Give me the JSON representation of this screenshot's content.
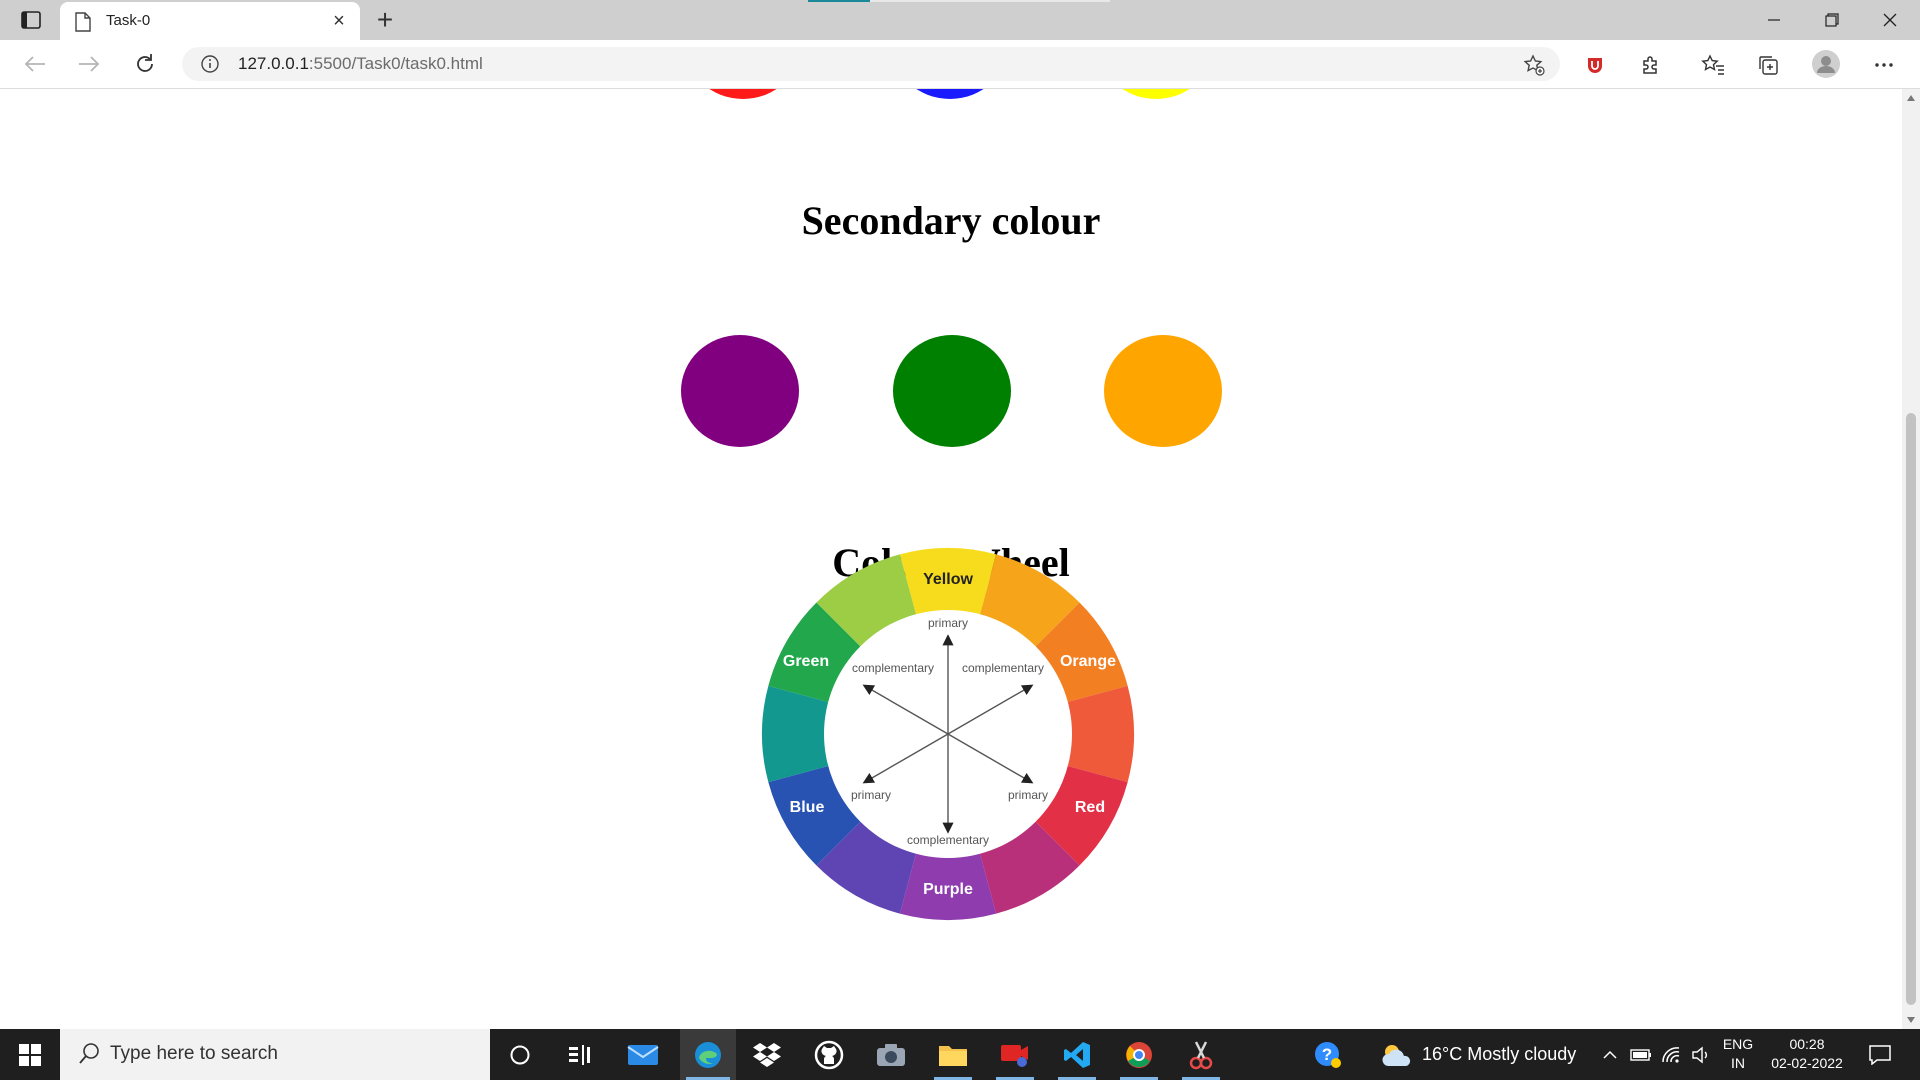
{
  "browser": {
    "tab_title": "Task-0",
    "url_host": "127.0.0.1",
    "url_rest": ":5500/Task0/task0.html"
  },
  "page": {
    "primary_circles_colors": [
      "#ff1a1a",
      "#1a1aff",
      "#ffff00"
    ],
    "secondary_heading": "Secondary colour",
    "secondary_colors": [
      "#800080",
      "#008000",
      "#ffa500"
    ],
    "wheel_heading": "Colour Wheel",
    "wheel": {
      "labels": {
        "yellow": "Yellow",
        "orange": "Orange",
        "red": "Red",
        "purple": "Purple",
        "blue": "Blue",
        "green": "Green"
      },
      "inner": {
        "primary_top": "primary",
        "primary_left": "primary",
        "primary_right": "primary",
        "comp_left": "complementary",
        "comp_right": "complementary",
        "comp_bottom": "complementary"
      }
    }
  },
  "taskbar": {
    "search_placeholder": "Type here to search",
    "weather": "16°C  Mostly cloudy",
    "lang_top": "ENG",
    "lang_bottom": "IN",
    "time": "00:28",
    "date": "02-02-2022"
  }
}
